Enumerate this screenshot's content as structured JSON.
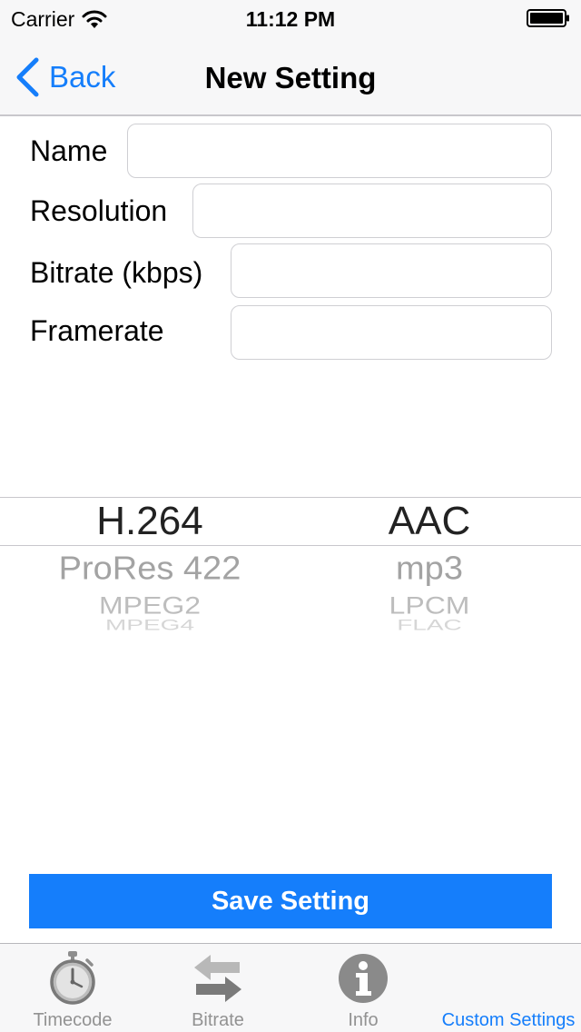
{
  "status_bar": {
    "carrier": "Carrier",
    "time": "11:12 PM",
    "wifi_icon": "wifi-icon",
    "battery_icon": "battery-icon"
  },
  "nav": {
    "back_label": "Back",
    "back_icon": "chevron-left-icon",
    "title": "New Setting"
  },
  "form": {
    "name_label": "Name",
    "name_value": "",
    "resolution_label": "Resolution",
    "resolution_value": "",
    "bitrate_label": "Bitrate (kbps)",
    "bitrate_value": "",
    "framerate_label": "Framerate",
    "framerate_value": ""
  },
  "picker": {
    "video_codecs": [
      "H.264",
      "ProRes 422",
      "MPEG2",
      "MPEG4"
    ],
    "video_selected": "H.264",
    "audio_codecs": [
      "AAC",
      "mp3",
      "LPCM",
      "FLAC"
    ],
    "audio_selected": "AAC"
  },
  "save_button_label": "Save Setting",
  "tabs": [
    {
      "label": "Timecode",
      "icon": "stopwatch-icon",
      "active": false
    },
    {
      "label": "Bitrate",
      "icon": "swap-arrows-icon",
      "active": false
    },
    {
      "label": "Info",
      "icon": "info-icon",
      "active": false
    },
    {
      "label": "Custom Settings",
      "icon": "",
      "active": true
    }
  ],
  "colors": {
    "accent": "#157efb",
    "tab_inactive": "#929292",
    "bar_background": "#f7f7f8"
  }
}
